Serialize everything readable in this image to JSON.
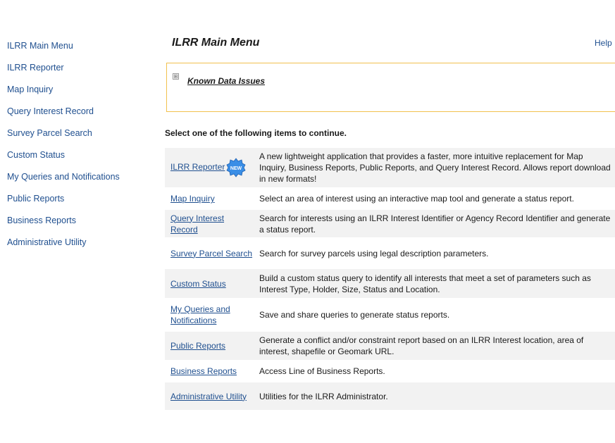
{
  "sidebar": {
    "items": [
      {
        "label": "ILRR Main Menu"
      },
      {
        "label": "ILRR Reporter"
      },
      {
        "label": "Map Inquiry"
      },
      {
        "label": "Query Interest Record"
      },
      {
        "label": "Survey Parcel Search"
      },
      {
        "label": "Custom Status"
      },
      {
        "label": "My Queries and Notifications"
      },
      {
        "label": "Public Reports"
      },
      {
        "label": "Business Reports"
      },
      {
        "label": "Administrative Utility"
      }
    ]
  },
  "header": {
    "title": "ILRR Main Menu",
    "help_label": "Help"
  },
  "notice": {
    "link_label": "Known Data Issues",
    "expand_symbol": "⊞"
  },
  "instruction": "Select one of the following items to continue.",
  "new_badge_text": "NEW",
  "items": [
    {
      "name": "ILRR Reporter",
      "desc": "A new lightweight application that provides a faster, more intuitive replacement for Map Inquiry, Business Reports, Public Reports, and Query Interest Record. Allows report download in new formats!"
    },
    {
      "name": "Map Inquiry",
      "desc": "Select an area of interest using an interactive map tool and generate a status report."
    },
    {
      "name": "Query Interest Record",
      "desc": "Search for interests using an ILRR Interest Identifier or Agency Record Identifier and generate a status report."
    },
    {
      "name": "Survey Parcel Search",
      "desc": "Search for survey parcels using legal description parameters."
    },
    {
      "name": "Custom Status",
      "desc": "Build a custom status query to identify all interests that meet a set of parameters such as Interest Type, Holder, Size, Status and Location."
    },
    {
      "name": "My Queries and Notifications",
      "desc": "Save and share queries to generate status reports."
    },
    {
      "name": "Public Reports",
      "desc": "Generate a conflict and/or constraint report based on an ILRR Interest location, area of interest, shapefile or Geomark URL."
    },
    {
      "name": "Business Reports",
      "desc": "Access Line of Business Reports."
    },
    {
      "name": "Administrative Utility",
      "desc": "Utilities for the ILRR Administrator."
    }
  ]
}
